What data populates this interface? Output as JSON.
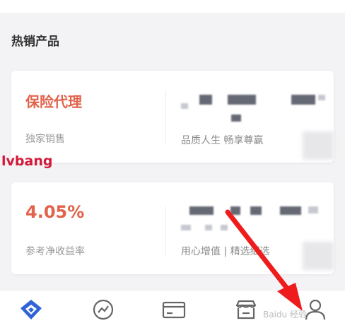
{
  "section": {
    "title": "热销产品"
  },
  "cards": [
    {
      "big_text": "保险代理",
      "sub_text": "独家销售",
      "right_text": "品质人生 畅享尊赢"
    },
    {
      "big_text": "4.05%",
      "sub_text": "参考净收益率",
      "right_text": "用心增值 | 精选细选"
    }
  ],
  "overlay": {
    "text": "lvbang"
  },
  "tabs": [
    {
      "icon": "shield-diamond-icon",
      "active": true
    },
    {
      "icon": "chart-circle-icon"
    },
    {
      "icon": "card-icon"
    },
    {
      "icon": "store-icon"
    },
    {
      "icon": "user-icon"
    }
  ],
  "watermark": {
    "text": "Baidu 经验"
  },
  "colors": {
    "accent": "#e2624a",
    "active_tab": "#2f63d6",
    "arrow": "#ee1c1c",
    "overlay": "#d2193a"
  }
}
